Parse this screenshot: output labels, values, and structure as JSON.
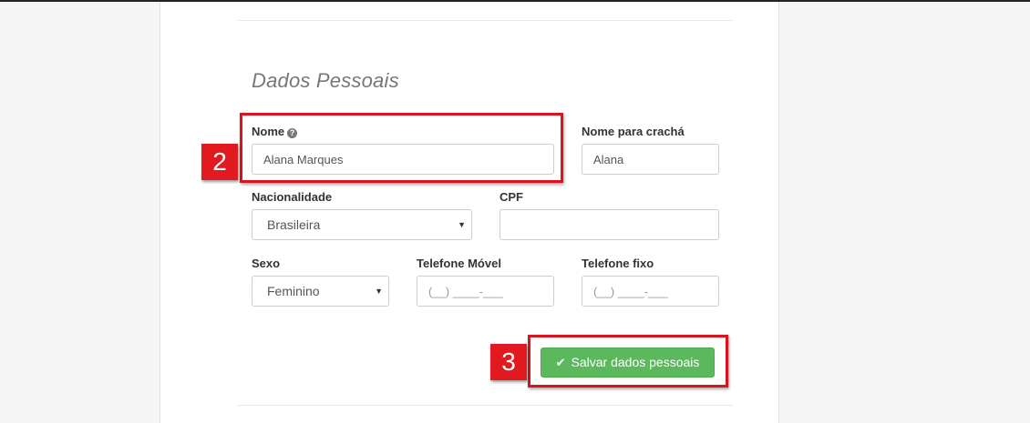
{
  "section": {
    "title": "Dados Pessoais"
  },
  "fields": {
    "nome": {
      "label": "Nome",
      "value": "Alana Marques"
    },
    "cracha": {
      "label": "Nome para crachá",
      "value": "Alana"
    },
    "nacionalidade": {
      "label": "Nacionalidade",
      "value": "Brasileira"
    },
    "cpf": {
      "label": "CPF",
      "value": ""
    },
    "sexo": {
      "label": "Sexo",
      "value": "Feminino"
    },
    "telefone_movel": {
      "label": "Telefone Móvel",
      "placeholder": "(__) ____-___"
    },
    "telefone_fixo": {
      "label": "Telefone fixo",
      "placeholder": "(__) ____-___"
    }
  },
  "actions": {
    "save_label": "Salvar dados pessoais"
  },
  "markers": {
    "step_2": "2",
    "step_3": "3"
  },
  "icons": {
    "help": "question-circle-icon",
    "check": "check-icon",
    "caret": "caret-down-icon"
  },
  "colors": {
    "accent_green": "#5cb85c",
    "marker_red": "#e01a1f"
  }
}
